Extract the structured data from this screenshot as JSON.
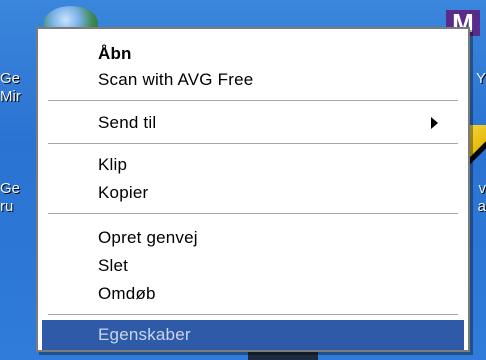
{
  "desktop": {
    "left_labels_top": [
      "Ge",
      "Mir"
    ],
    "left_labels_mid": [
      "Ge",
      "ru"
    ],
    "right_label_top_1": "Y",
    "right_label_mid_1": "v",
    "right_label_mid_2": "a",
    "icon_right_top_letter": "M"
  },
  "context_menu": {
    "items": [
      {
        "label": "Åbn"
      },
      {
        "label": "Scan with AVG Free"
      },
      {
        "label": "Send til"
      },
      {
        "label": "Klip"
      },
      {
        "label": "Kopier"
      },
      {
        "label": "Opret genvej"
      },
      {
        "label": "Slet"
      },
      {
        "label": "Omdøb"
      },
      {
        "label": "Egenskaber"
      }
    ],
    "colors": {
      "highlight": "#2f5aa8",
      "highlight_text": "#c9d6ee",
      "border": "#7b7b7b"
    }
  }
}
